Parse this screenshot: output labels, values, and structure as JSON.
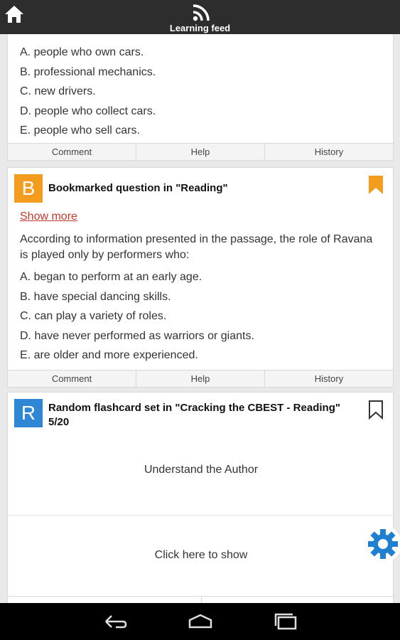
{
  "header": {
    "title": "Learning feed",
    "home_icon": "home-icon",
    "feed_icon": "rss-feed-icon"
  },
  "card1": {
    "answers": [
      "A. people who own cars.",
      "B. professional mechanics.",
      "C. new drivers.",
      "D. people who collect cars.",
      "E. people who sell cars."
    ],
    "footer": {
      "comment": "Comment",
      "help": "Help",
      "history": "History"
    }
  },
  "card2": {
    "badge": "B",
    "badge_color": "#f39c1e",
    "title": "Bookmarked question in \"Reading\"",
    "bookmark_color": "#f39c1e",
    "show_more": "Show more",
    "question": "According to information presented in the passage, the role of Ravana is played only by performers who:",
    "answers": [
      "A. began to perform at an early age.",
      "B. have special dancing skills.",
      "C. can play a variety of roles.",
      "D. have never performed as warriors or giants.",
      "E. are older and more experienced."
    ],
    "footer": {
      "comment": "Comment",
      "help": "Help",
      "history": "History"
    }
  },
  "card3": {
    "badge": "R",
    "badge_color": "#2f86d5",
    "title_line1": "Random flashcard set in \"Cracking the CBEST - Reading\"",
    "title_line2": "5/20",
    "front": "Understand the Author",
    "show": "Click here to show"
  },
  "settings_icon": "gear-icon",
  "nav": {
    "back": "back-icon",
    "home": "home-nav-icon",
    "recents": "recents-icon"
  }
}
